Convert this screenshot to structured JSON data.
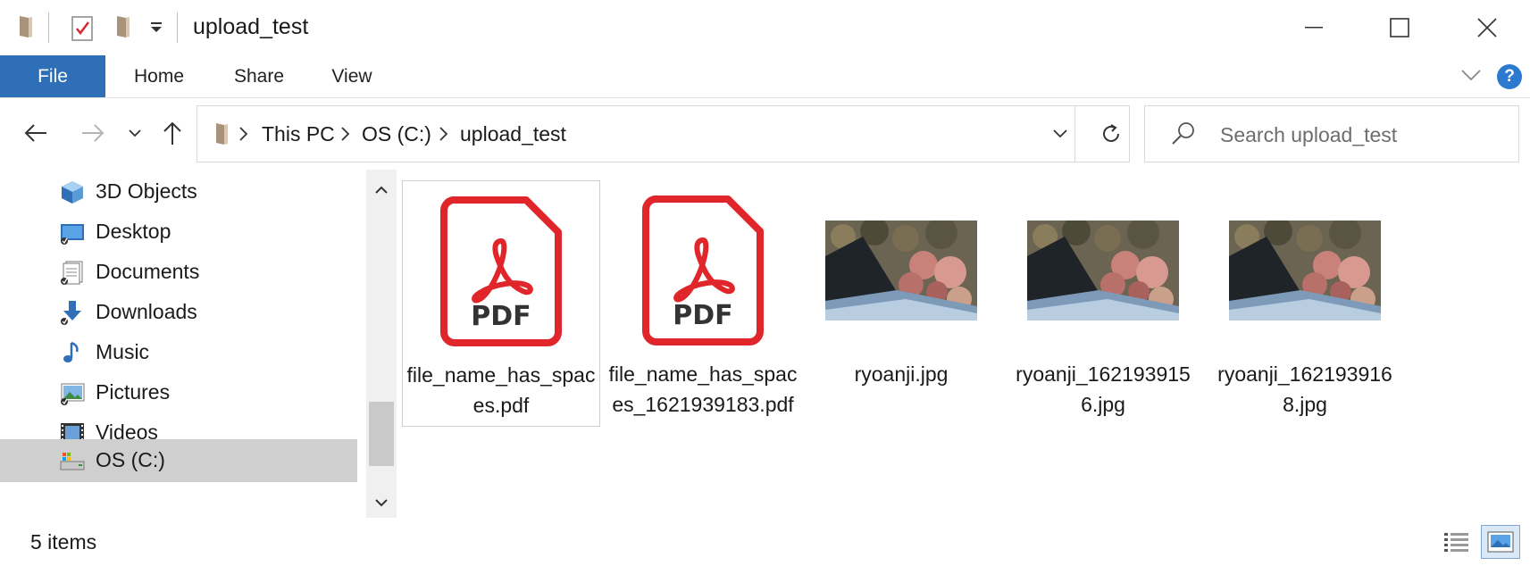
{
  "window": {
    "title": "upload_test"
  },
  "ribbon": {
    "tabs": [
      "File",
      "Home",
      "Share",
      "View"
    ]
  },
  "address": {
    "breadcrumbs": [
      "This PC",
      "OS (C:)",
      "upload_test"
    ],
    "search_placeholder": "Search upload_test"
  },
  "nav_pane": {
    "items": [
      {
        "label": "3D Objects",
        "icon": "3d-objects-icon"
      },
      {
        "label": "Desktop",
        "icon": "desktop-icon"
      },
      {
        "label": "Documents",
        "icon": "documents-icon"
      },
      {
        "label": "Downloads",
        "icon": "downloads-icon"
      },
      {
        "label": "Music",
        "icon": "music-icon"
      },
      {
        "label": "Pictures",
        "icon": "pictures-icon"
      },
      {
        "label": "Videos",
        "icon": "videos-icon"
      },
      {
        "label": "OS (C:)",
        "icon": "drive-icon"
      }
    ],
    "selected": "OS (C:)"
  },
  "files": [
    {
      "name": "file_name_has_spaces.pdf",
      "type": "pdf",
      "selected": true
    },
    {
      "name": "file_name_has_spaces_1621939183.pdf",
      "type": "pdf",
      "selected": false
    },
    {
      "name": "ryoanji.jpg",
      "type": "jpg",
      "selected": false
    },
    {
      "name": "ryoanji_1621939156.jpg",
      "type": "jpg",
      "selected": false
    },
    {
      "name": "ryoanji_1621939168.jpg",
      "type": "jpg",
      "selected": false
    }
  ],
  "status": {
    "item_count": "5 items"
  },
  "colors": {
    "accent": "#2f6fb7",
    "pdf_red": "#e0262b",
    "selection_gray": "#cfcfcf"
  }
}
